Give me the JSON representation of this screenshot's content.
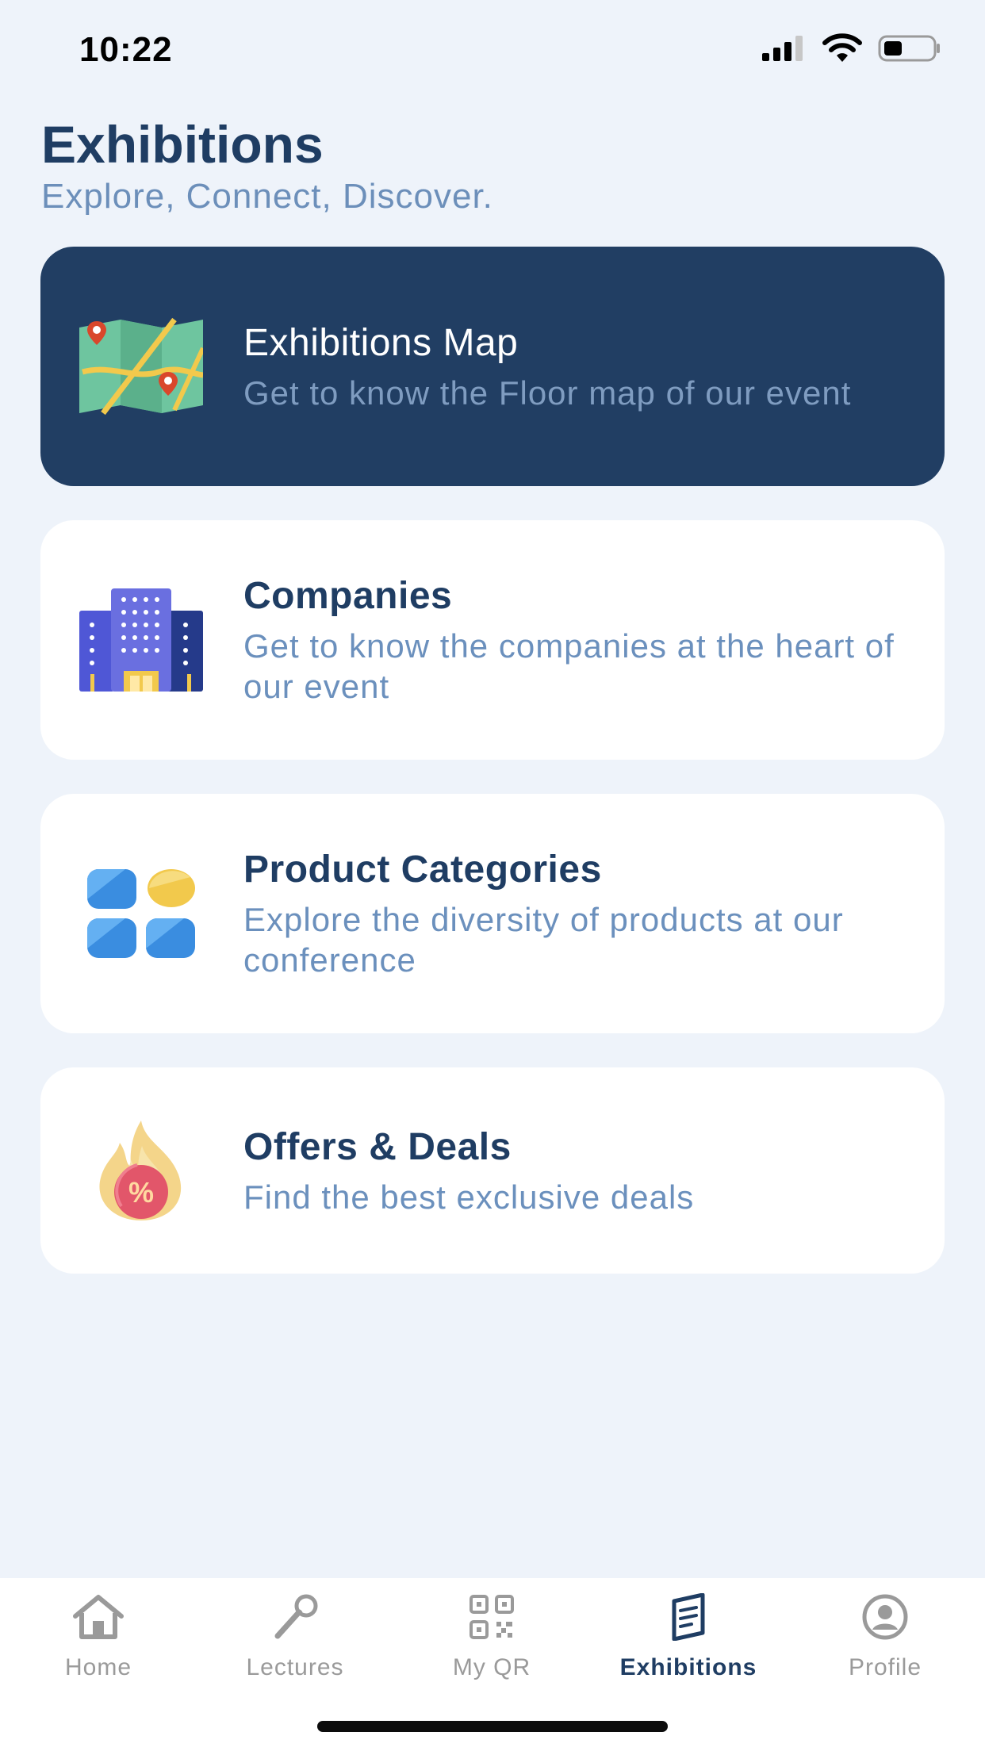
{
  "status_bar": {
    "time": "10:22"
  },
  "header": {
    "title": "Exhibitions",
    "subtitle": "Explore, Connect, Discover."
  },
  "cards": [
    {
      "title": "Exhibitions Map",
      "description": "Get to know the Floor map of our event",
      "icon": "map-icon",
      "active": true
    },
    {
      "title": "Companies",
      "description": "Get to know the companies at the heart of our event",
      "icon": "building-icon",
      "active": false
    },
    {
      "title": "Product Categories",
      "description": "Explore the diversity of products at our conference",
      "icon": "categories-icon",
      "active": false
    },
    {
      "title": "Offers & Deals",
      "description": "Find the best exclusive deals",
      "icon": "fire-percent-icon",
      "active": false
    }
  ],
  "tab_bar": {
    "items": [
      {
        "label": "Home",
        "icon": "home-icon"
      },
      {
        "label": "Lectures",
        "icon": "microphone-icon"
      },
      {
        "label": "My QR",
        "icon": "qr-code-icon"
      },
      {
        "label": "Exhibitions",
        "icon": "document-icon",
        "active": true
      },
      {
        "label": "Profile",
        "icon": "profile-icon"
      }
    ]
  },
  "colors": {
    "background": "#eef3fa",
    "primary": "#213e63",
    "accent_text": "#6b90bd",
    "inactive_tab": "#9a9a9a"
  }
}
